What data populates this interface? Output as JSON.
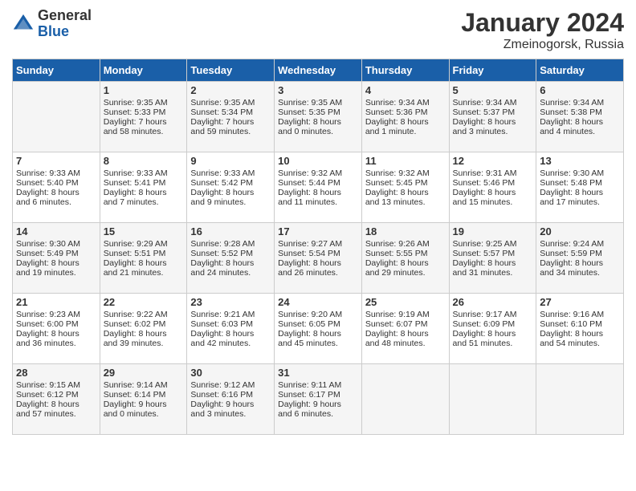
{
  "header": {
    "logo_general": "General",
    "logo_blue": "Blue",
    "title": "January 2024",
    "location": "Zmeinogorsk, Russia"
  },
  "days_of_week": [
    "Sunday",
    "Monday",
    "Tuesday",
    "Wednesday",
    "Thursday",
    "Friday",
    "Saturday"
  ],
  "weeks": [
    [
      {
        "day": "",
        "info": ""
      },
      {
        "day": "1",
        "info": "Sunrise: 9:35 AM\nSunset: 5:33 PM\nDaylight: 7 hours\nand 58 minutes."
      },
      {
        "day": "2",
        "info": "Sunrise: 9:35 AM\nSunset: 5:34 PM\nDaylight: 7 hours\nand 59 minutes."
      },
      {
        "day": "3",
        "info": "Sunrise: 9:35 AM\nSunset: 5:35 PM\nDaylight: 8 hours\nand 0 minutes."
      },
      {
        "day": "4",
        "info": "Sunrise: 9:34 AM\nSunset: 5:36 PM\nDaylight: 8 hours\nand 1 minute."
      },
      {
        "day": "5",
        "info": "Sunrise: 9:34 AM\nSunset: 5:37 PM\nDaylight: 8 hours\nand 3 minutes."
      },
      {
        "day": "6",
        "info": "Sunrise: 9:34 AM\nSunset: 5:38 PM\nDaylight: 8 hours\nand 4 minutes."
      }
    ],
    [
      {
        "day": "7",
        "info": "Sunrise: 9:33 AM\nSunset: 5:40 PM\nDaylight: 8 hours\nand 6 minutes."
      },
      {
        "day": "8",
        "info": "Sunrise: 9:33 AM\nSunset: 5:41 PM\nDaylight: 8 hours\nand 7 minutes."
      },
      {
        "day": "9",
        "info": "Sunrise: 9:33 AM\nSunset: 5:42 PM\nDaylight: 8 hours\nand 9 minutes."
      },
      {
        "day": "10",
        "info": "Sunrise: 9:32 AM\nSunset: 5:44 PM\nDaylight: 8 hours\nand 11 minutes."
      },
      {
        "day": "11",
        "info": "Sunrise: 9:32 AM\nSunset: 5:45 PM\nDaylight: 8 hours\nand 13 minutes."
      },
      {
        "day": "12",
        "info": "Sunrise: 9:31 AM\nSunset: 5:46 PM\nDaylight: 8 hours\nand 15 minutes."
      },
      {
        "day": "13",
        "info": "Sunrise: 9:30 AM\nSunset: 5:48 PM\nDaylight: 8 hours\nand 17 minutes."
      }
    ],
    [
      {
        "day": "14",
        "info": "Sunrise: 9:30 AM\nSunset: 5:49 PM\nDaylight: 8 hours\nand 19 minutes."
      },
      {
        "day": "15",
        "info": "Sunrise: 9:29 AM\nSunset: 5:51 PM\nDaylight: 8 hours\nand 21 minutes."
      },
      {
        "day": "16",
        "info": "Sunrise: 9:28 AM\nSunset: 5:52 PM\nDaylight: 8 hours\nand 24 minutes."
      },
      {
        "day": "17",
        "info": "Sunrise: 9:27 AM\nSunset: 5:54 PM\nDaylight: 8 hours\nand 26 minutes."
      },
      {
        "day": "18",
        "info": "Sunrise: 9:26 AM\nSunset: 5:55 PM\nDaylight: 8 hours\nand 29 minutes."
      },
      {
        "day": "19",
        "info": "Sunrise: 9:25 AM\nSunset: 5:57 PM\nDaylight: 8 hours\nand 31 minutes."
      },
      {
        "day": "20",
        "info": "Sunrise: 9:24 AM\nSunset: 5:59 PM\nDaylight: 8 hours\nand 34 minutes."
      }
    ],
    [
      {
        "day": "21",
        "info": "Sunrise: 9:23 AM\nSunset: 6:00 PM\nDaylight: 8 hours\nand 36 minutes."
      },
      {
        "day": "22",
        "info": "Sunrise: 9:22 AM\nSunset: 6:02 PM\nDaylight: 8 hours\nand 39 minutes."
      },
      {
        "day": "23",
        "info": "Sunrise: 9:21 AM\nSunset: 6:03 PM\nDaylight: 8 hours\nand 42 minutes."
      },
      {
        "day": "24",
        "info": "Sunrise: 9:20 AM\nSunset: 6:05 PM\nDaylight: 8 hours\nand 45 minutes."
      },
      {
        "day": "25",
        "info": "Sunrise: 9:19 AM\nSunset: 6:07 PM\nDaylight: 8 hours\nand 48 minutes."
      },
      {
        "day": "26",
        "info": "Sunrise: 9:17 AM\nSunset: 6:09 PM\nDaylight: 8 hours\nand 51 minutes."
      },
      {
        "day": "27",
        "info": "Sunrise: 9:16 AM\nSunset: 6:10 PM\nDaylight: 8 hours\nand 54 minutes."
      }
    ],
    [
      {
        "day": "28",
        "info": "Sunrise: 9:15 AM\nSunset: 6:12 PM\nDaylight: 8 hours\nand 57 minutes."
      },
      {
        "day": "29",
        "info": "Sunrise: 9:14 AM\nSunset: 6:14 PM\nDaylight: 9 hours\nand 0 minutes."
      },
      {
        "day": "30",
        "info": "Sunrise: 9:12 AM\nSunset: 6:16 PM\nDaylight: 9 hours\nand 3 minutes."
      },
      {
        "day": "31",
        "info": "Sunrise: 9:11 AM\nSunset: 6:17 PM\nDaylight: 9 hours\nand 6 minutes."
      },
      {
        "day": "",
        "info": ""
      },
      {
        "day": "",
        "info": ""
      },
      {
        "day": "",
        "info": ""
      }
    ]
  ]
}
